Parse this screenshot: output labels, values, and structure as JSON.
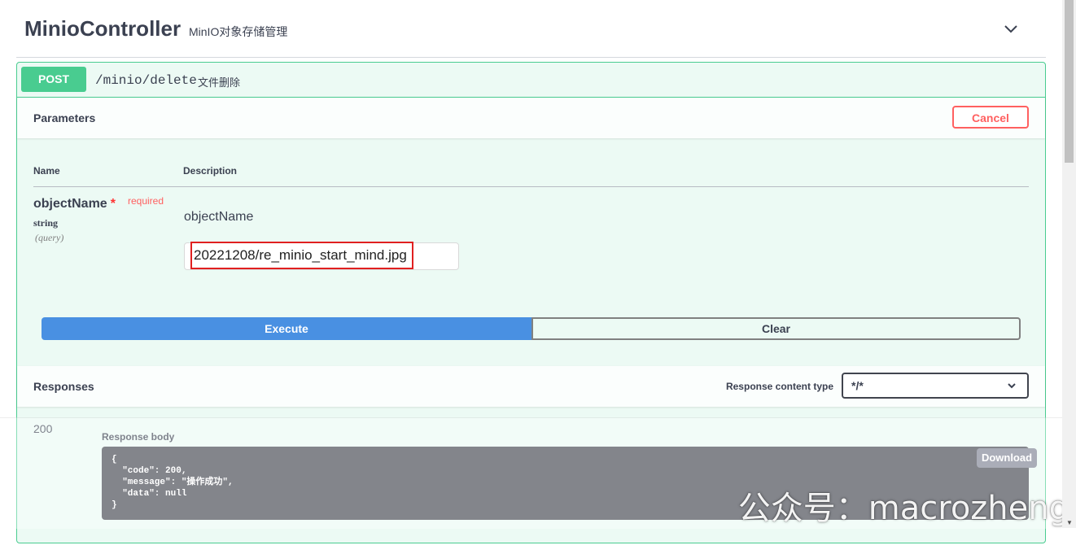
{
  "tag": {
    "title": "MinioController",
    "description": "MinIO对象存储管理",
    "toggle_icon": "chevron-down-icon"
  },
  "operation": {
    "method": "POST",
    "path": "/minio/delete",
    "summary": "文件删除",
    "method_color": "#49cc90"
  },
  "parameters": {
    "section_title": "Parameters",
    "cancel_label": "Cancel",
    "columns": {
      "name": "Name",
      "description": "Description"
    },
    "items": [
      {
        "name": "objectName",
        "required_star": "*",
        "required_label": "required",
        "type": "string",
        "in": "(query)",
        "description": "objectName",
        "value": "20221208/re_minio_start_mind.jpg"
      }
    ]
  },
  "actions": {
    "execute_label": "Execute",
    "clear_label": "Clear",
    "execute_color": "#4990e2"
  },
  "responses": {
    "section_title": "Responses",
    "content_type_label": "Response content type",
    "content_type_value": "*/*",
    "status_code": "200",
    "body_label": "Response body",
    "body": "{\n  \"code\": 200,\n  \"message\": \"操作成功\",\n  \"data\": null\n}",
    "download_label": "Download"
  },
  "watermark": "公众号：macrozheng"
}
